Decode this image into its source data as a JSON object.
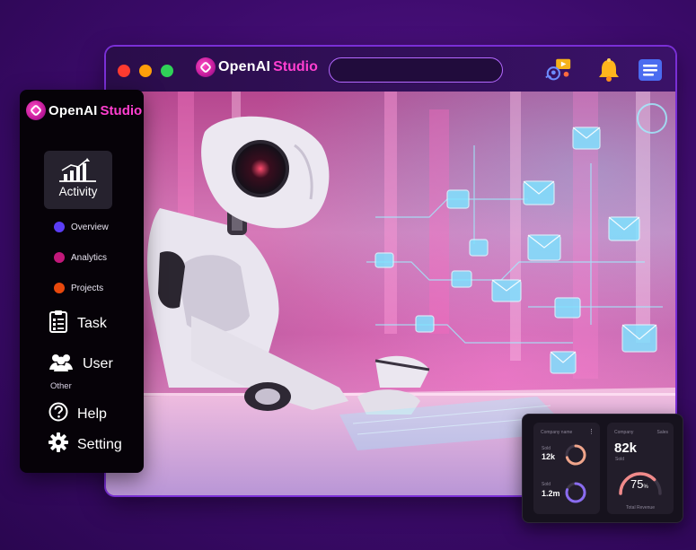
{
  "app": {
    "brand_primary": "OpenAI",
    "brand_secondary": "Studio",
    "accent": "#ff3fd0",
    "frame_color": "#7a2fd6"
  },
  "header": {
    "search": {
      "value": "",
      "placeholder": ""
    },
    "icons": [
      "video-chat-icon",
      "bell-icon",
      "menu-icon"
    ]
  },
  "sidebar": {
    "brand_primary": "OpenAI",
    "brand_secondary": "Studio",
    "activity": {
      "label": "Activity",
      "icon": "chart-icon"
    },
    "sub_items": [
      {
        "label": "Overview",
        "color": "#5b3df5"
      },
      {
        "label": "Analytics",
        "color": "#c2187a"
      },
      {
        "label": "Projects",
        "color": "#e8480c"
      }
    ],
    "task": {
      "label": "Task"
    },
    "user": {
      "label": "User"
    },
    "other_label": "Other",
    "help": {
      "label": "Help"
    },
    "setting": {
      "label": "Setting"
    }
  },
  "widget": {
    "left_card": {
      "title": "Company name",
      "stat1": {
        "value": "12k",
        "caption": "Sold",
        "progress": 0.7,
        "color": "#f0a58b"
      },
      "stat2": {
        "value": "1.2m",
        "caption": "Sold",
        "progress": 0.8,
        "color": "#8a6cf0"
      }
    },
    "right_card": {
      "title": "Company",
      "subtitle": "Sales",
      "value": "82k",
      "value_caption": "Sold",
      "percent": "75",
      "percent_unit": "%",
      "gauge": 0.75,
      "footer": "Total Revenue",
      "color": "#f08a8a"
    }
  }
}
